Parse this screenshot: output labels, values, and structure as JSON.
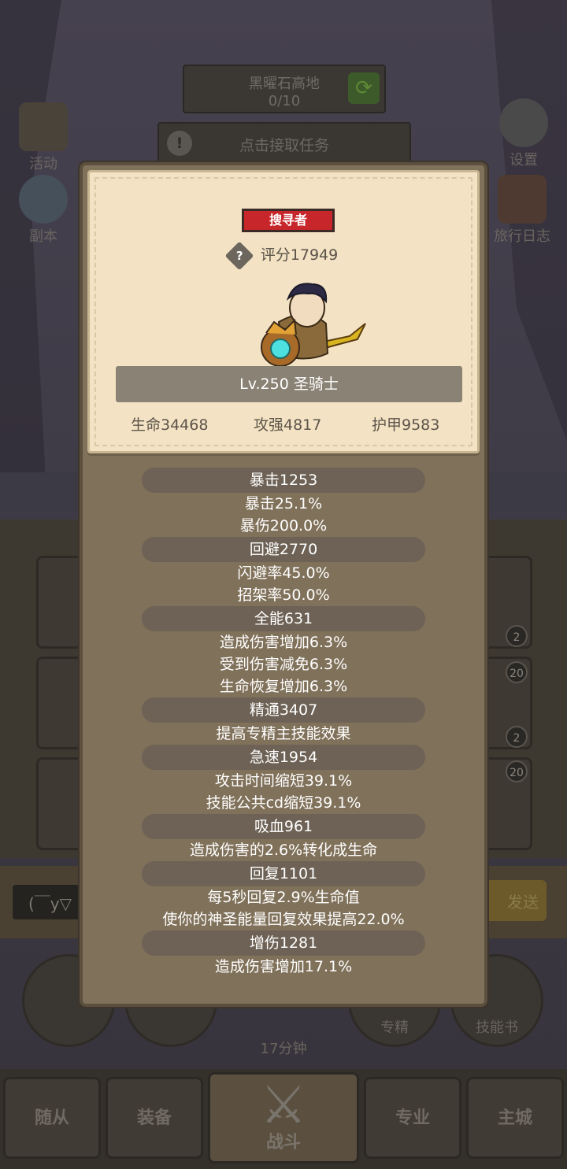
{
  "background": {
    "quest_name": "黑曜石高地",
    "quest_progress": "0/10",
    "accept_task": "点击接取任务",
    "left_buttons": [
      "活动",
      "副本"
    ],
    "right_buttons": [
      "设置",
      "旅行日志"
    ],
    "slot_badges": [
      "2",
      "20",
      "2",
      "20"
    ],
    "chat_placeholder": "(￣y▽",
    "send_label": "发送",
    "circle_buttons": [
      "专精",
      "技能书"
    ],
    "timer": "17分钟",
    "tabs": [
      "随从",
      "装备",
      "战斗",
      "专业",
      "主城"
    ]
  },
  "profile": {
    "title": "搜寻者",
    "help_icon": "?",
    "score": "评分17949",
    "level": "Lv.250 圣骑士",
    "stats": {
      "hp": "生命34468",
      "attack": "攻强4817",
      "armor": "护甲9583"
    }
  },
  "attributes": [
    {
      "header": "暴击1253",
      "lines": [
        "暴击25.1%",
        "暴伤200.0%"
      ]
    },
    {
      "header": "回避2770",
      "lines": [
        "闪避率45.0%",
        "招架率50.0%"
      ]
    },
    {
      "header": "全能631",
      "lines": [
        "造成伤害增加6.3%",
        "受到伤害减免6.3%",
        "生命恢复增加6.3%"
      ]
    },
    {
      "header": "精通3407",
      "lines": [
        "提高专精主技能效果"
      ]
    },
    {
      "header": "急速1954",
      "lines": [
        "攻击时间缩短39.1%",
        "技能公共cd缩短39.1%"
      ]
    },
    {
      "header": "吸血961",
      "lines": [
        "造成伤害的2.6%转化成生命"
      ]
    },
    {
      "header": "回复1101",
      "lines": [
        "每5秒回复2.9%生命值",
        "使你的神圣能量回复效果提高22.0%"
      ]
    },
    {
      "header": "增伤1281",
      "lines": [
        "造成伤害增加17.1%"
      ]
    }
  ],
  "colors": {
    "title_badge": "#c7262a",
    "card_bg": "#f3e3c4",
    "panel_bg": "#80715a",
    "attr_header_bg": "#6d6255"
  }
}
